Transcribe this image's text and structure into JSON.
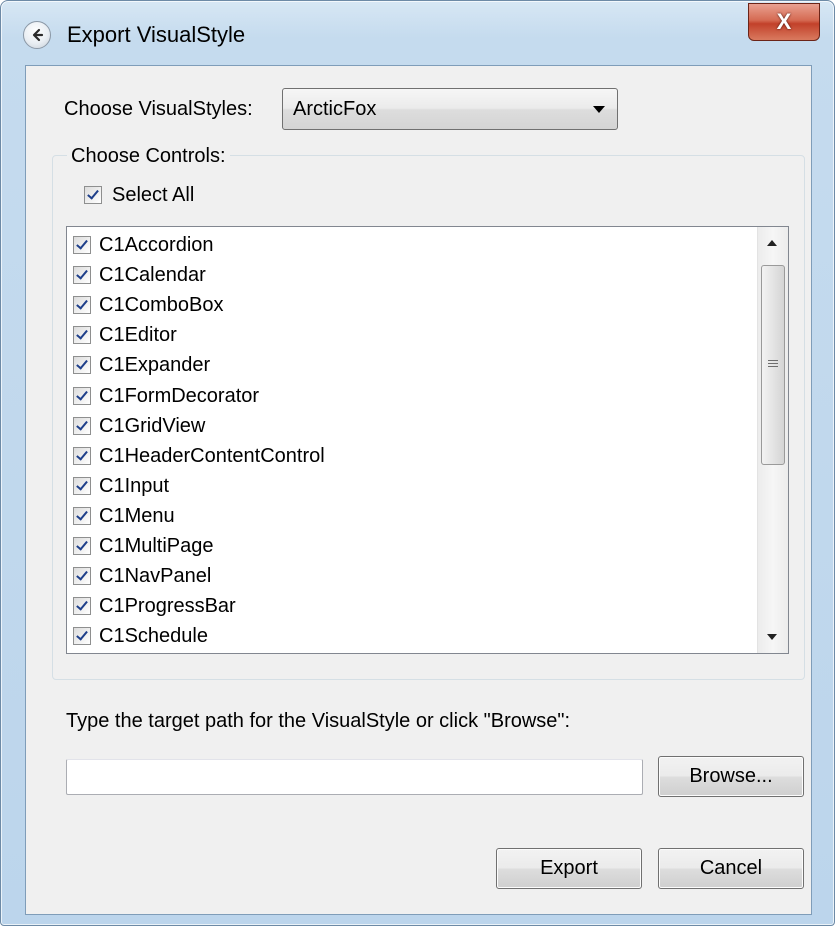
{
  "window": {
    "title": "Export VisualStyle",
    "close_label": "X"
  },
  "visual_styles": {
    "label": "Choose VisualStyles:",
    "selected": "ArcticFox"
  },
  "controls_group": {
    "legend": "Choose Controls:",
    "select_all_label": "Select All",
    "select_all_checked": true,
    "items": [
      {
        "label": "C1Accordion",
        "checked": true
      },
      {
        "label": "C1Calendar",
        "checked": true
      },
      {
        "label": "C1ComboBox",
        "checked": true
      },
      {
        "label": "C1Editor",
        "checked": true
      },
      {
        "label": "C1Expander",
        "checked": true
      },
      {
        "label": "C1FormDecorator",
        "checked": true
      },
      {
        "label": "C1GridView",
        "checked": true
      },
      {
        "label": "C1HeaderContentControl",
        "checked": true
      },
      {
        "label": "C1Input",
        "checked": true
      },
      {
        "label": "C1Menu",
        "checked": true
      },
      {
        "label": "C1MultiPage",
        "checked": true
      },
      {
        "label": "C1NavPanel",
        "checked": true
      },
      {
        "label": "C1ProgressBar",
        "checked": true
      },
      {
        "label": "C1Schedule",
        "checked": true
      }
    ]
  },
  "path": {
    "label": "Type the target path for the VisualStyle or  click \"Browse\":",
    "value": "",
    "browse_label": "Browse..."
  },
  "actions": {
    "export_label": "Export",
    "cancel_label": "Cancel"
  },
  "icons": {
    "back": "back-arrow-icon",
    "close": "close-icon",
    "dropdown": "chevron-down-icon",
    "scroll_up": "scroll-up-arrow-icon",
    "scroll_down": "scroll-down-arrow-icon",
    "check": "checkmark-icon"
  }
}
